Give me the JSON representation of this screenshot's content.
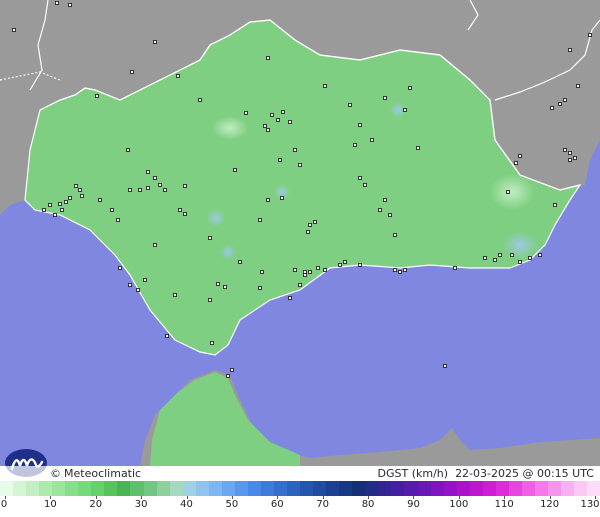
{
  "map": {
    "brand": "Meteoclimatic",
    "copyright_symbol": "©",
    "variable": "DGST (km/h)",
    "timestamp": "22-03-2025 @ 00:15 UTC",
    "colors": {
      "sea": "#7f87e0",
      "land_outside": "#9a9a9a",
      "region": "#7fcf82",
      "border": "#ffffff",
      "station": "#111111"
    }
  },
  "legend": {
    "ticks": [
      "0",
      "10",
      "20",
      "30",
      "40",
      "50",
      "60",
      "70",
      "80",
      "90",
      "100",
      "110",
      "120",
      "130"
    ],
    "colors": [
      "#e8fbe8",
      "#d5f5d5",
      "#c2f0c2",
      "#aeeaae",
      "#9be59c",
      "#88df8b",
      "#76d97a",
      "#66d16c",
      "#58c35e",
      "#4db455",
      "#5fbf6a",
      "#74c684",
      "#8fcf9e",
      "#a6d8c0",
      "#9fd0e3",
      "#90c3ee",
      "#7fb5f0",
      "#6da7ef",
      "#5b98ec",
      "#4a89e6",
      "#3e7bd9",
      "#356ecb",
      "#2d62bd",
      "#2556ae",
      "#1f4ba0",
      "#1a4192",
      "#173883",
      "#163076",
      "#222c84",
      "#332592",
      "#4420a0",
      "#561bae",
      "#6a17b8",
      "#7f14c0",
      "#9412c7",
      "#aa12cc",
      "#be16d0",
      "#d01dd4",
      "#df2cd8",
      "#ea44de",
      "#f05fe3",
      "#f37ae7",
      "#f695ec",
      "#f8b0f0",
      "#fac8f4",
      "#fcdcf8"
    ]
  }
}
